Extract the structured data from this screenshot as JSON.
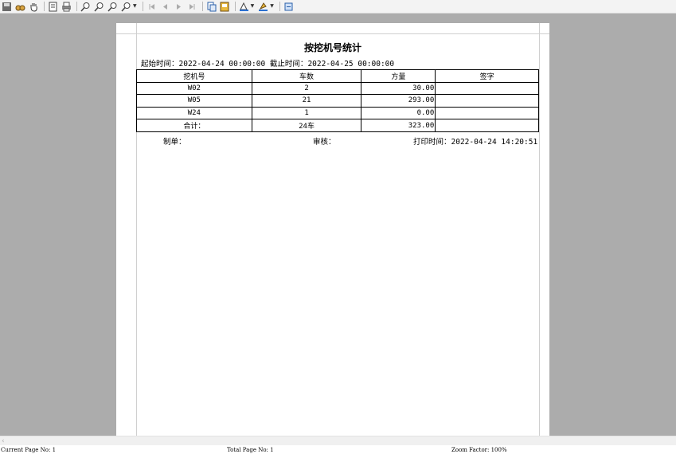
{
  "toolbar": {
    "icons": [
      "save-icon",
      "find-icon",
      "hand-icon",
      "print-setup-icon",
      "print-icon",
      "zoom-in-icon",
      "zoom-out-icon",
      "zoom-fit-icon",
      "zoom-icon",
      "first-page-icon",
      "prev-page-icon",
      "next-page-icon",
      "last-page-icon",
      "copy-icon",
      "export-icon",
      "page-color-icon",
      "watermark-icon",
      "exit-icon"
    ]
  },
  "report": {
    "title": "按挖机号统计",
    "start_label": "起始时间：",
    "start_value": "2022-04-24 00:00:00",
    "end_label": "截止时间：",
    "end_value": "2022-04-25 00:00:00",
    "headers": [
      "挖机号",
      "车数",
      "方量",
      "签字"
    ],
    "rows": [
      {
        "machine": "W02",
        "trucks": "2",
        "volume": "30.00",
        "sign": ""
      },
      {
        "machine": "W05",
        "trucks": "21",
        "volume": "293.00",
        "sign": ""
      },
      {
        "machine": "W24",
        "trucks": "1",
        "volume": "0.00",
        "sign": ""
      }
    ],
    "total": {
      "label": "合计：",
      "trucks": "24车",
      "volume": "323.00",
      "sign": ""
    },
    "maker_label": "制单：",
    "reviewer_label": "审核：",
    "print_label": "打印时间：",
    "print_value": "2022-04-24 14:20:51"
  },
  "status": {
    "current_page": "Current Page No: 1",
    "total_page": "Total Page No: 1",
    "zoom": "Zoom Factor: 100%"
  }
}
